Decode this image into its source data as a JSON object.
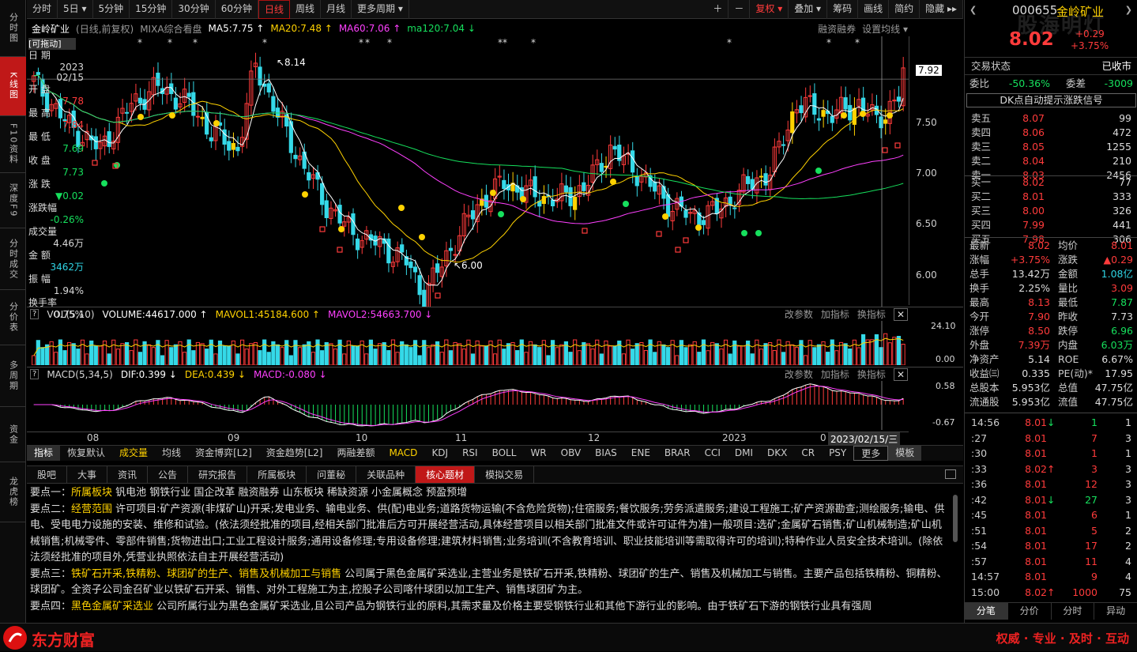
{
  "left_nav": [
    "分时图",
    "K线图",
    "F10资料",
    "深度F9",
    "分时成交",
    "分价表",
    "多周期",
    "资金",
    "龙虎榜"
  ],
  "topbar": {
    "periods": [
      "分时",
      "5日 ▾",
      "5分钟",
      "15分钟",
      "30分钟",
      "60分钟",
      "日线",
      "周线",
      "月线",
      "更多周期 ▾"
    ],
    "tools": [
      "＋",
      "－",
      "复权 ▾",
      "叠加 ▾",
      "筹码",
      "画线",
      "简约",
      "隐藏 ▸▸"
    ]
  },
  "chart_info": {
    "name": "金岭矿业",
    "sub": "(日线,前复权)",
    "mixa": "MIXA综合看盘",
    "ma5": "MA5:7.75 ↑",
    "ma20": "MA20:7.48 ↑",
    "ma60": "MA60:7.06 ↑",
    "ma120": "ma120:7.04 ↓",
    "margin": "融资融券",
    "setting": "设置均线 ▾"
  },
  "info_box": {
    "drag": "[可拖动]",
    "date_label": "日 期",
    "date_year": "2023",
    "date_md": "02/15",
    "open_label": "开 盘",
    "open": "7.78",
    "high_label": "最 高",
    "high": "7.84",
    "low_label": "最 低",
    "low": "7.69",
    "close_label": "收 盘",
    "close": "7.73",
    "chg_label": "涨 跌",
    "chg": "▼0.02",
    "pct_label": "涨跌幅",
    "pct": "-0.26%",
    "vol_label": "成交量",
    "vol": "4.46万",
    "amt_label": "金 额",
    "amt": "3462万",
    "amp_label": "振 幅",
    "amp": "1.94%",
    "turn_label": "换手率",
    "turn": "0.75%"
  },
  "y_axis": [
    "7.92",
    "7.50",
    "7.00",
    "6.50",
    "6.00"
  ],
  "annotations": {
    "high": "8.14",
    "low": "6.00"
  },
  "vol": {
    "header": "VOL(5,10)",
    "volume": "VOLUME:44617.000 ↑",
    "mavol1": "MAVOL1:45184.600 ↑",
    "mavol2": "MAVOL2:54663.700 ↓",
    "y_top": "24.10",
    "y_bot": "0.00",
    "btns": [
      "改参数",
      "加指标",
      "换指标"
    ]
  },
  "macd": {
    "header": "MACD(5,34,5)",
    "dif": "DIF:0.399 ↓",
    "dea": "DEA:0.439 ↓",
    "macd": "MACD:-0.080 ↓",
    "y_top": "0.58",
    "y_bot": "-0.67"
  },
  "x_axis": [
    "08",
    "09",
    "10",
    "11",
    "12",
    "2023",
    "0"
  ],
  "x_cursor": "2023/02/15/三",
  "ind_tabs": [
    "指标",
    "恢复默认",
    "成交量",
    "均线",
    "资金博弈[L2]",
    "资金趋势[L2]",
    "两融差额",
    "MACD",
    "KDJ",
    "RSI",
    "BOLL",
    "WR",
    "OBV",
    "BIAS",
    "ENE",
    "BRAR",
    "CCI",
    "DMI",
    "DKX",
    "CR",
    "PSY",
    "更多",
    "模板"
  ],
  "info_tabs": [
    "股吧",
    "大事",
    "资讯",
    "公告",
    "研究报告",
    "所属板块",
    "问董秘",
    "关联品种",
    "核心题材",
    "模拟交易"
  ],
  "core_text": [
    {
      "k": "要点一：",
      "t": "所属板块",
      "b": "   钒电池 钢铁行业 国企改革 融资融券 山东板块 稀缺资源 小金属概念 预盈预增"
    },
    {
      "k": "要点二：",
      "t": "经营范围",
      "b": "   许可项目:矿产资源(非煤矿山)开采;发电业务、输电业务、供(配)电业务;道路货物运输(不含危险货物);住宿服务;餐饮服务;劳务派遣服务;建设工程施工;矿产资源勘查;测绘服务;输电、供电、受电电力设施的安装、维修和试验。(依法须经批准的项目,经相关部门批准后方可开展经营活动,具体经营项目以相关部门批准文件或许可证件为准)一般项目:选矿;金属矿石销售;矿山机械制造;矿山机械销售;机械零件、零部件销售;货物进出口;工业工程设计服务;通用设备修理;专用设备修理;建筑材料销售;业务培训(不含教育培训、职业技能培训等需取得许可的培训);特种作业人员安全技术培训。(除依法须经批准的项目外,凭营业执照依法自主开展经营活动)"
    },
    {
      "k": "要点三：",
      "t": "铁矿石开采,铁精粉、球团矿的生产、销售及机械加工与销售",
      "b": "   公司属于黑色金属矿采选业,主营业务是铁矿石开采,铁精粉、球团矿的生产、销售及机械加工与销售。主要产品包括铁精粉、铜精粉、球团矿。全资子公司金召矿业以铁矿石开采、销售、对外工程施工为主,控股子公司喀什球团以加工生产、销售球团矿为主。"
    },
    {
      "k": "要点四：",
      "t": "黑色金属矿采选业",
      "b": "   公司所属行业为黑色金属矿采选业,且公司产品为钢铁行业的原料,其需求量及价格主要受钢铁行业和其他下游行业的影响。由于铁矿石下游的钢铁行业具有强周"
    }
  ],
  "quote": {
    "code": "000655",
    "name": "金岭矿业",
    "price": "8.02",
    "chg": "+0.29",
    "pct": "+3.75%",
    "status_label": "交易状态",
    "status": "已收市",
    "wb_label": "委比",
    "wb": "-50.36%",
    "wc_label": "委差",
    "wc": "-3009",
    "dk": "DK点自动提示涨跌信号",
    "watermark": "股海明灯"
  },
  "asks": [
    [
      "卖五",
      "8.07",
      "99"
    ],
    [
      "卖四",
      "8.06",
      "472"
    ],
    [
      "卖三",
      "8.05",
      "1255"
    ],
    [
      "卖二",
      "8.04",
      "210"
    ],
    [
      "卖一",
      "8.03",
      "2456"
    ]
  ],
  "bids": [
    [
      "买一",
      "8.02",
      "77"
    ],
    [
      "买二",
      "8.01",
      "333"
    ],
    [
      "买三",
      "8.00",
      "326"
    ],
    [
      "买四",
      "7.99",
      "441"
    ],
    [
      "买五",
      "7.98",
      "306"
    ]
  ],
  "stats": [
    [
      "最新",
      "8.02",
      "均价",
      "8.01"
    ],
    [
      "涨幅",
      "+3.75%",
      "涨跌",
      "▲0.29"
    ],
    [
      "总手",
      "13.42万",
      "金额",
      "1.08亿"
    ],
    [
      "换手",
      "2.25%",
      "量比",
      "3.09"
    ],
    [
      "最高",
      "8.13",
      "最低",
      "7.87"
    ],
    [
      "今开",
      "7.90",
      "昨收",
      "7.73"
    ],
    [
      "涨停",
      "8.50",
      "跌停",
      "6.96"
    ],
    [
      "外盘",
      "7.39万",
      "内盘",
      "6.03万"
    ],
    [
      "净资产",
      "5.14",
      "ROE",
      "6.67%"
    ],
    [
      "收益㈢",
      "0.335",
      "PE(动)*",
      "17.95"
    ],
    [
      "总股本",
      "5.953亿",
      "总值",
      "47.75亿"
    ],
    [
      "流通股",
      "5.953亿",
      "流值",
      "47.75亿"
    ]
  ],
  "ticks": [
    [
      "14:56",
      "8.01",
      "↓",
      "1",
      "1"
    ],
    [
      ":27",
      "8.01",
      "",
      "7",
      "3"
    ],
    [
      ":30",
      "8.01",
      "",
      "1",
      "1"
    ],
    [
      ":33",
      "8.02",
      "↑",
      "3",
      "3"
    ],
    [
      ":36",
      "8.01",
      "",
      "12",
      "3"
    ],
    [
      ":42",
      "8.01",
      "↓",
      "27",
      "3"
    ],
    [
      ":45",
      "8.01",
      "",
      "6",
      "1"
    ],
    [
      ":51",
      "8.01",
      "",
      "5",
      "2"
    ],
    [
      ":54",
      "8.01",
      "",
      "17",
      "2"
    ],
    [
      ":57",
      "8.01",
      "",
      "11",
      "4"
    ],
    [
      "14:57",
      "8.01",
      "",
      "9",
      "4"
    ],
    [
      "15:00",
      "8.02",
      "↑",
      "1000",
      "75"
    ]
  ],
  "right_tabs": [
    "分笔",
    "分价",
    "分时",
    "异动"
  ],
  "footer": {
    "brand": "东方财富",
    "slogan": "权威 · 专业 · 及时 · 互动"
  },
  "chart_data": {
    "type": "candlestick",
    "note": "daily K-line Aug 2022 - Feb 2023",
    "ylim": [
      5.9,
      8.3
    ],
    "annotated_high": 8.14,
    "annotated_low": 6.0,
    "last_close": 8.02
  }
}
